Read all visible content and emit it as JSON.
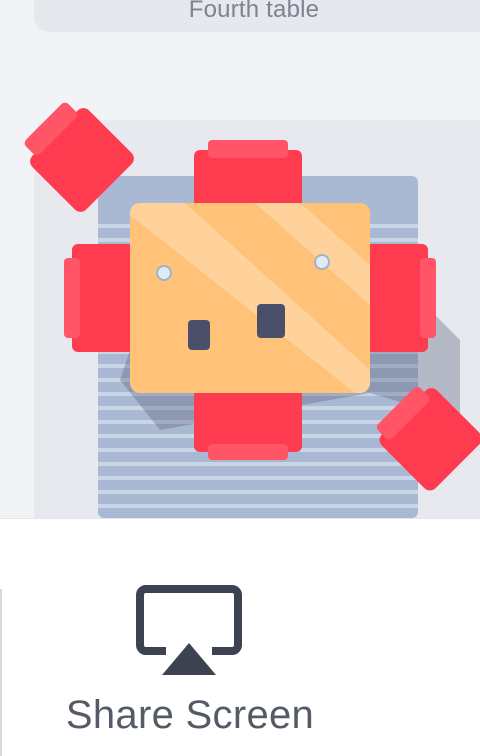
{
  "table_list": {
    "previous_table_label": "Fourth table"
  },
  "toolbar": {
    "share_screen_label": "Share Screen",
    "share_screen_icon": "airplay-screen-icon"
  },
  "colors": {
    "chair_red": "#ff3b50",
    "table_orange": "#ffc278",
    "rug_blue": "#aab9d3",
    "card_bg": "#e7e9ee",
    "icon_dark": "#3c4250"
  }
}
